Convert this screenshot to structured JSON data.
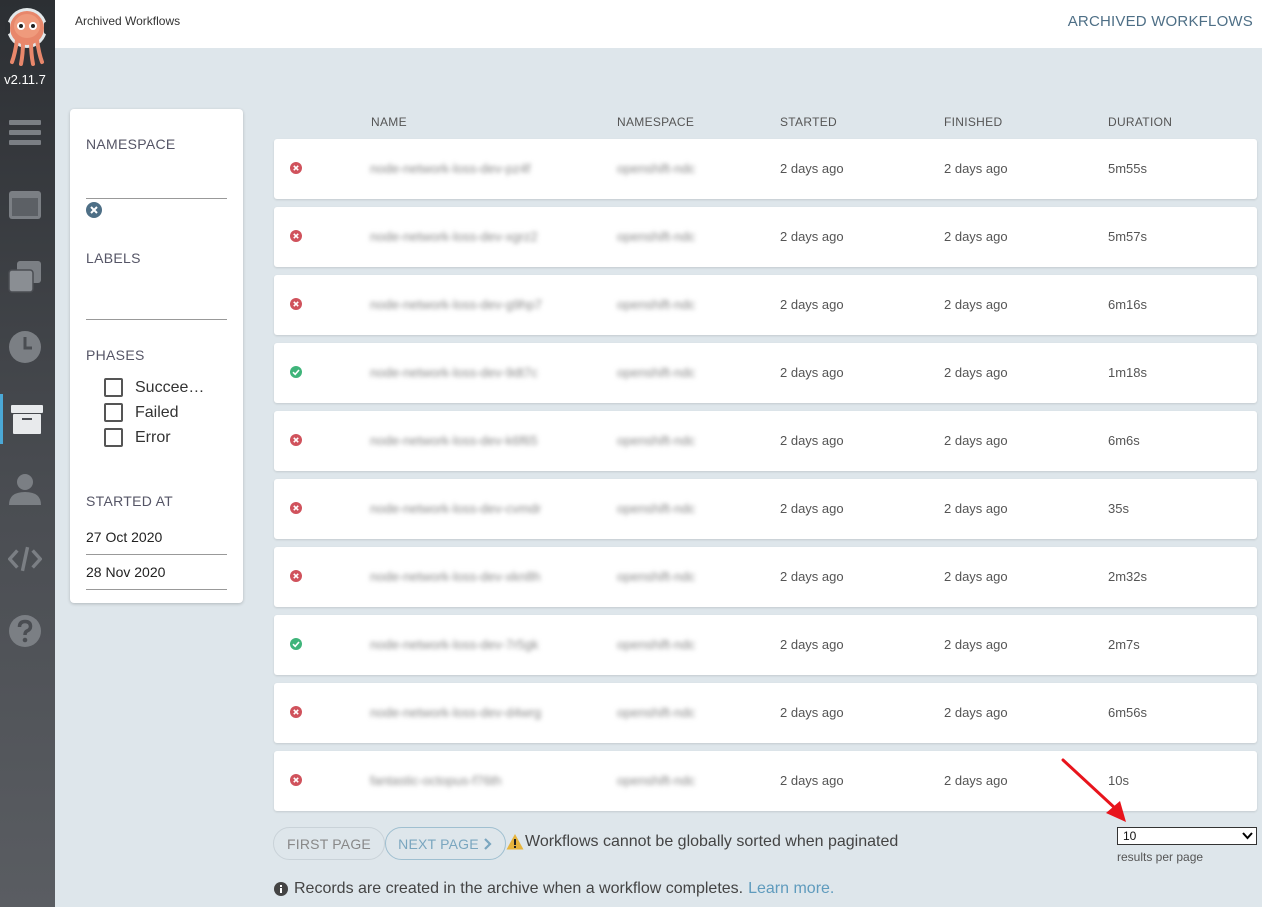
{
  "app": {
    "version": "v2.11.7",
    "breadcrumb": "Archived Workflows",
    "page_title": "ARCHIVED WORKFLOWS"
  },
  "nav": {
    "items": [
      {
        "icon": "stream-icon"
      },
      {
        "icon": "workflow-templates-icon"
      },
      {
        "icon": "cluster-templates-icon"
      },
      {
        "icon": "cron-clock-icon"
      },
      {
        "icon": "archive-icon",
        "active": true
      },
      {
        "icon": "user-icon"
      },
      {
        "icon": "api-docs-code-icon"
      },
      {
        "icon": "help-icon"
      }
    ]
  },
  "filters": {
    "namespace_label": "NAMESPACE",
    "namespace_value": "",
    "labels_label": "LABELS",
    "phases_label": "PHASES",
    "phases": [
      {
        "label": "Succee…",
        "checked": false
      },
      {
        "label": "Failed",
        "checked": false
      },
      {
        "label": "Error",
        "checked": false
      }
    ],
    "started_at_label": "STARTED AT",
    "start_date": "27 Oct 2020",
    "end_date": "28 Nov 2020"
  },
  "table": {
    "columns": [
      "NAME",
      "NAMESPACE",
      "STARTED",
      "FINISHED",
      "DURATION"
    ],
    "rows": [
      {
        "status": "failed",
        "name": "node-network-loss-dev-pz4f",
        "namespace": "openshift-ndc",
        "started": "2 days ago",
        "finished": "2 days ago",
        "duration": "5m55s"
      },
      {
        "status": "failed",
        "name": "node-network-loss-dev-xgrz2",
        "namespace": "openshift-ndc",
        "started": "2 days ago",
        "finished": "2 days ago",
        "duration": "5m57s"
      },
      {
        "status": "failed",
        "name": "node-network-loss-dev-g9hp7",
        "namespace": "openshift-ndc",
        "started": "2 days ago",
        "finished": "2 days ago",
        "duration": "6m16s"
      },
      {
        "status": "succeeded",
        "name": "node-network-loss-dev-9dt7c",
        "namespace": "openshift-ndc",
        "started": "2 days ago",
        "finished": "2 days ago",
        "duration": "1m18s"
      },
      {
        "status": "failed",
        "name": "node-network-loss-dev-k6f65",
        "namespace": "openshift-ndc",
        "started": "2 days ago",
        "finished": "2 days ago",
        "duration": "6m6s"
      },
      {
        "status": "failed",
        "name": "node-network-loss-dev-cvmdr",
        "namespace": "openshift-ndc",
        "started": "2 days ago",
        "finished": "2 days ago",
        "duration": "35s"
      },
      {
        "status": "failed",
        "name": "node-network-loss-dev-xkn8h",
        "namespace": "openshift-ndc",
        "started": "2 days ago",
        "finished": "2 days ago",
        "duration": "2m32s"
      },
      {
        "status": "succeeded",
        "name": "node-network-loss-dev-7r5gk",
        "namespace": "openshift-ndc",
        "started": "2 days ago",
        "finished": "2 days ago",
        "duration": "2m7s"
      },
      {
        "status": "failed",
        "name": "node-network-loss-dev-d4wrg",
        "namespace": "openshift-ndc",
        "started": "2 days ago",
        "finished": "2 days ago",
        "duration": "6m56s"
      },
      {
        "status": "failed",
        "name": "fantastic-octopus-f76th",
        "namespace": "openshift-ndc",
        "started": "2 days ago",
        "finished": "2 days ago",
        "duration": "10s"
      }
    ]
  },
  "pagination": {
    "first_page": "FIRST PAGE",
    "next_page": "NEXT PAGE",
    "warning": "Workflows cannot be globally sorted when paginated",
    "page_size": "10",
    "results_per_page": "results per page"
  },
  "footer": {
    "info": "Records are created in the archive when a workflow completes.",
    "learn_more": "Learn more."
  },
  "colors": {
    "failed": "#d0525c",
    "succeeded": "#3fb47a",
    "accent": "#5f9bbd",
    "annotation_arrow": "#e8141c"
  }
}
